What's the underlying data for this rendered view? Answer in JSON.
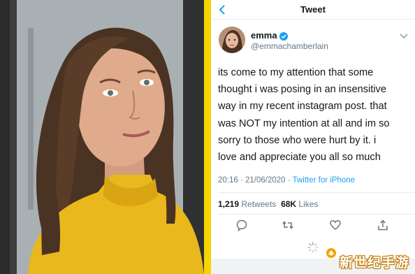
{
  "header": {
    "title": "Tweet",
    "back_icon": "chevron-left-icon"
  },
  "author": {
    "name": "emma",
    "handle": "@emmachamberlain",
    "verified_icon": "verified-badge-icon",
    "menu_icon": "chevron-down-icon"
  },
  "tweet": {
    "lines": [
      "its come to my attention that some",
      "thought i was posing in an insensitive",
      "way in my recent instagram post. that",
      "was NOT my intention at all and im so",
      "sorry to those who were hurt by it. i",
      "love and appreciate you all so much"
    ],
    "timestamp": "20:16 · 21/06/2020 · ",
    "source": "Twitter for iPhone"
  },
  "stats": {
    "retweets_count": "1,219",
    "retweets_label": "Retweets",
    "likes_count": "68K",
    "likes_label": "Likes"
  },
  "actions": [
    "reply-icon",
    "retweet-icon",
    "like-icon",
    "share-icon"
  ],
  "watermark": {
    "text": "新世纪手游"
  },
  "colors": {
    "accent": "#1da1f2",
    "divider": "#f5d400",
    "sweater": "#e8b81c"
  }
}
